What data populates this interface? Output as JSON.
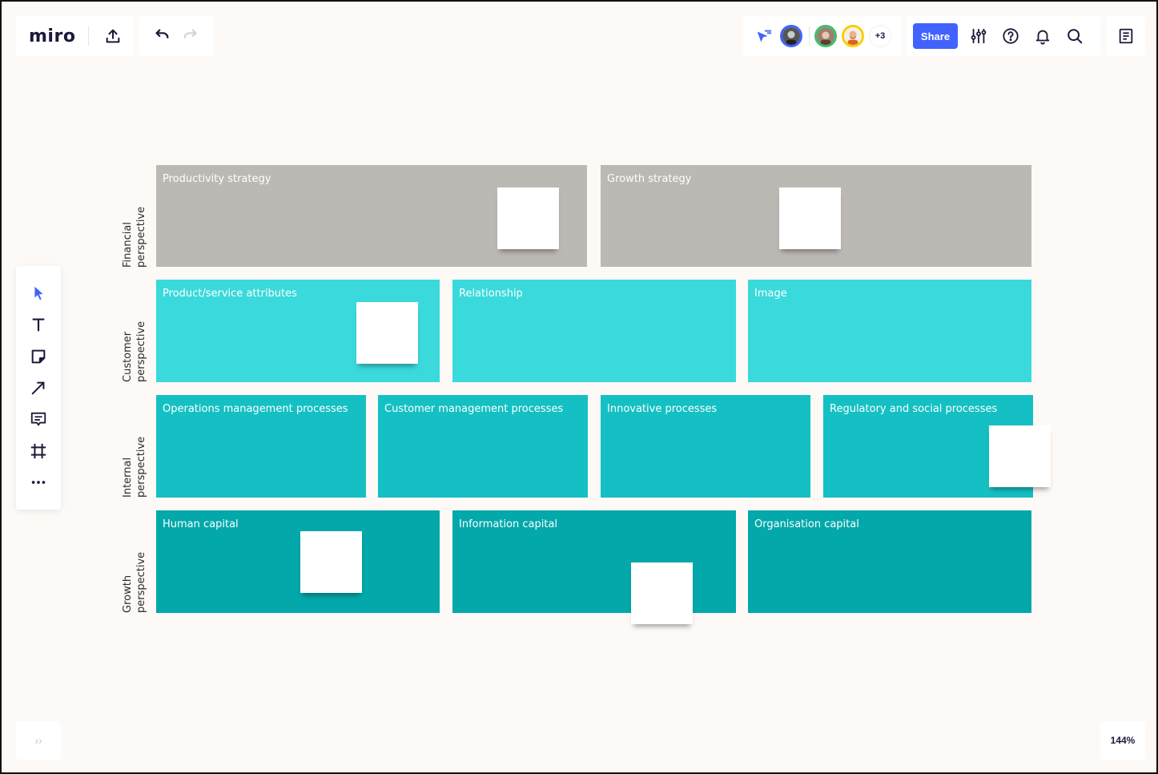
{
  "app": {
    "logo": "miro",
    "share_label": "Share",
    "zoom_level": "144%",
    "more_collaborators": "+3",
    "expand_label": "››"
  },
  "icons": {
    "export": "upload-icon",
    "undo": "undo-icon",
    "redo": "redo-icon",
    "follow": "cursor-follow-icon",
    "settings": "sliders-icon",
    "help": "help-icon",
    "notifications": "bell-icon",
    "search": "search-icon",
    "notes": "notes-icon"
  },
  "colors": {
    "accent": "#4262ff",
    "financial": "#bcb8b4",
    "customer": "#3ad9dc",
    "internal": "#14c0c3",
    "growth": "#03a8aa",
    "avatar_borders": [
      "#4262ff",
      "#3dbf6a",
      "#f5d000"
    ]
  },
  "toolbar": [
    {
      "name": "select-tool",
      "icon": "cursor-icon"
    },
    {
      "name": "text-tool",
      "icon": "text-icon"
    },
    {
      "name": "sticky-note-tool",
      "icon": "sticky-note-icon"
    },
    {
      "name": "line-tool",
      "icon": "arrow-icon"
    },
    {
      "name": "comment-tool",
      "icon": "comment-icon"
    },
    {
      "name": "frame-tool",
      "icon": "frame-icon"
    },
    {
      "name": "more-tools",
      "icon": "more-icon"
    }
  ],
  "board": {
    "rows": [
      {
        "label_line1": "Financial",
        "label_line2": "perspective",
        "cells": [
          "Productivity strategy",
          "Growth strategy"
        ]
      },
      {
        "label_line1": "Customer",
        "label_line2": "perspective",
        "cells": [
          "Product/service attributes",
          "Relationship",
          "Image"
        ]
      },
      {
        "label_line1": "Internal",
        "label_line2": "perspective",
        "cells": [
          "Operations management processes",
          "Customer management processes",
          "Innovative processes",
          "Regulatory and social processes"
        ]
      },
      {
        "label_line1": "Growth",
        "label_line2": "perspective",
        "cells": [
          "Human capital",
          "Information capital",
          "Organisation capital"
        ]
      }
    ]
  }
}
